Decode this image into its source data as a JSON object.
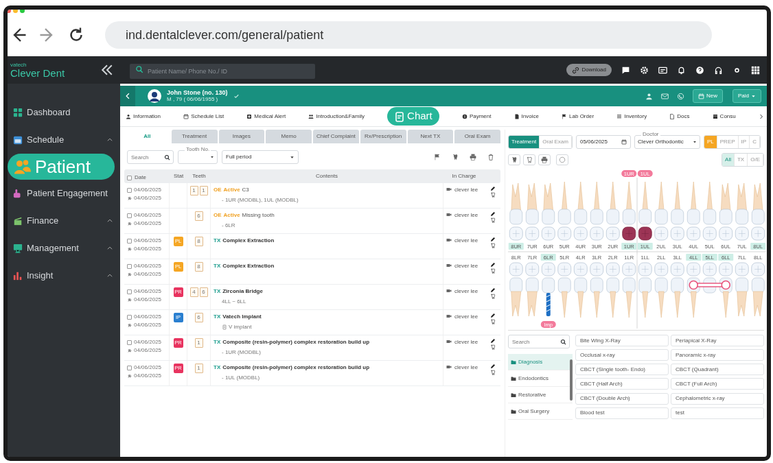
{
  "browser": {
    "dots": [
      {
        "color": "#ff5f57"
      },
      {
        "color": "#febc2e"
      },
      {
        "color": "#28c840"
      }
    ],
    "nav": [
      {
        "kind": "back",
        "disabled": false
      },
      {
        "kind": "forward",
        "disabled": true
      },
      {
        "kind": "reload",
        "disabled": false
      }
    ],
    "url": "ind.dentalclever.com/general/patient"
  },
  "sidebar": {
    "brand_small": "vatech",
    "brand": "Clever Dent",
    "items": [
      {
        "label": "Dashboard",
        "kind": "link",
        "selected": false
      },
      {
        "label": "Schedule",
        "kind": "group",
        "selected": false
      },
      {
        "label": "Patient",
        "kind": "link",
        "selected": true
      },
      {
        "label": "Patient Engagement",
        "kind": "link",
        "selected": false
      },
      {
        "label": "Finance",
        "kind": "group",
        "selected": false
      },
      {
        "label": "Management",
        "kind": "group",
        "selected": false
      },
      {
        "label": "Insight",
        "kind": "group",
        "selected": false
      }
    ]
  },
  "header": {
    "search_placeholder": "Patient Name/ Phone No./ ID",
    "pill": "Download"
  },
  "patient": {
    "name": "John Stone (no. 130)",
    "info": "M , 79 ( 06/06/1955 )",
    "new_label": "New",
    "status_label": "Paid"
  },
  "menu": [
    {
      "label": "Information",
      "selected": false
    },
    {
      "label": "Schedule List",
      "selected": false
    },
    {
      "label": "Medical Alert",
      "selected": false
    },
    {
      "label": "Introduction&Family",
      "selected": false
    },
    {
      "label": "Chart",
      "selected": true
    },
    {
      "label": "Payment",
      "selected": false
    },
    {
      "label": "Invoice",
      "selected": false
    },
    {
      "label": "Lab Order",
      "selected": false
    },
    {
      "label": "Inventory",
      "selected": false
    },
    {
      "label": "Docs",
      "selected": false
    },
    {
      "label": "Consu",
      "selected": false
    }
  ],
  "subtabs": [
    {
      "label": "All",
      "selected": true
    },
    {
      "label": "Treatment",
      "selected": false
    },
    {
      "label": "Images",
      "selected": false
    },
    {
      "label": "Memo",
      "selected": false
    },
    {
      "label": "Chief Complaint",
      "selected": false
    },
    {
      "label": "Rx/Prescription",
      "selected": false
    },
    {
      "label": "Next TX",
      "selected": false
    },
    {
      "label": "Oral Exam",
      "selected": false
    }
  ],
  "filters": {
    "search_placeholder": "Search",
    "tooth_label": "Tooth No.",
    "period": "Full period"
  },
  "table": {
    "all_checked": false,
    "columns": [
      "Date",
      "Stat",
      "Teeth",
      "Contents",
      "In Charge"
    ],
    "rows": [
      {
        "checked": false,
        "date1": "04/06/2025",
        "date2": "04/06/2025",
        "teeth": [
          "1",
          "1"
        ],
        "kind": "exam",
        "prefix": "OE",
        "status": "Active",
        "title": "C3",
        "detail": "- 1UR (MODBL), 1UL (MODBL)",
        "doctor": "clever lee"
      },
      {
        "checked": false,
        "date1": "04/06/2025",
        "date2": "04/06/2025",
        "teeth": [
          "6"
        ],
        "kind": "exam",
        "prefix": "OE",
        "status": "Active",
        "title": "Missing tooth",
        "detail": "- 6LR",
        "doctor": "clever lee"
      },
      {
        "checked": false,
        "date1": "04/06/2025",
        "date2": "04/06/2025",
        "stat": {
          "text": "PL",
          "color": "#f5a623"
        },
        "teeth": [
          "8"
        ],
        "kind": "treatment",
        "prefix": "TX",
        "title": "Complex Extraction",
        "doctor": "clever lee"
      },
      {
        "checked": false,
        "date1": "04/06/2025",
        "date2": "04/06/2025",
        "stat": {
          "text": "PL",
          "color": "#f5a623"
        },
        "teeth": [
          "8"
        ],
        "kind": "treatment",
        "prefix": "TX",
        "title": "Complex Extraction",
        "doctor": "clever lee"
      },
      {
        "checked": false,
        "date1": "04/06/2025",
        "date2": "04/06/2025",
        "stat": {
          "text": "PR",
          "color": "#e8335f"
        },
        "teeth": [
          "4",
          "6"
        ],
        "kind": "treatment",
        "prefix": "TX",
        "title": "Zirconia Bridge",
        "detail": "4LL ~ 6LL",
        "doctor": "clever lee"
      },
      {
        "checked": false,
        "date1": "04/06/2025",
        "date2": "04/06/2025",
        "stat": {
          "text": "IP",
          "color": "#2a7fd0"
        },
        "teeth": [
          "6"
        ],
        "kind": "treatment",
        "prefix": "TX",
        "title": "Vatech Implant",
        "detail": "V implant",
        "detail_icon": true,
        "doctor": "clever lee"
      },
      {
        "checked": false,
        "date1": "04/06/2025",
        "date2": "04/06/2025",
        "stat": {
          "text": "PR",
          "color": "#e8335f"
        },
        "teeth": [
          "1"
        ],
        "kind": "treatment",
        "prefix": "TX",
        "title": "Composite (resin-polymer) complex restoration build up",
        "detail": "- 1UR (MODBL)",
        "doctor": "clever lee"
      },
      {
        "checked": false,
        "date1": "04/06/2025",
        "date2": "04/06/2025",
        "stat": {
          "text": "PR",
          "color": "#e8335f"
        },
        "teeth": [
          "1"
        ],
        "kind": "treatment",
        "prefix": "TX",
        "title": "Composite (resin-polymer) complex restoration build up",
        "detail": "- 1UL (MODBL)",
        "doctor": "clever lee"
      }
    ]
  },
  "chart_panel": {
    "mode_tabs": [
      {
        "label": "Treatment",
        "selected": true
      },
      {
        "label": "Oral Exam",
        "selected": false
      }
    ],
    "date": "05/06/2025",
    "doctor_label": "Doctor",
    "doctor": "Clever Orthodontic",
    "plan_tabs": [
      {
        "label": "PL",
        "selected": true
      },
      {
        "label": "PREP",
        "selected": false
      },
      {
        "label": "IP",
        "selected": false
      },
      {
        "label": "C",
        "selected": false
      }
    ],
    "filter_tabs": [
      {
        "label": "All",
        "selected": true
      },
      {
        "label": "TX",
        "selected": false
      },
      {
        "label": "O/E",
        "selected": false
      }
    ],
    "upper_teeth": [
      {
        "label": "8UR",
        "highlighted": true,
        "selected": false
      },
      {
        "label": "7UR",
        "highlighted": false,
        "selected": false
      },
      {
        "label": "6UR",
        "highlighted": false,
        "selected": false
      },
      {
        "label": "5UR",
        "highlighted": false,
        "selected": false
      },
      {
        "label": "4UR",
        "highlighted": false,
        "selected": false
      },
      {
        "label": "3UR",
        "highlighted": false,
        "selected": false
      },
      {
        "label": "2UR",
        "highlighted": false,
        "selected": false
      },
      {
        "label": "1UR",
        "highlighted": true,
        "selected": true,
        "badge": "1UR"
      },
      {
        "label": "1UL",
        "highlighted": true,
        "selected": true,
        "badge": "1UL"
      },
      {
        "label": "2UL",
        "highlighted": false,
        "selected": false
      },
      {
        "label": "3UL",
        "highlighted": false,
        "selected": false
      },
      {
        "label": "4UL",
        "highlighted": false,
        "selected": false
      },
      {
        "label": "5UL",
        "highlighted": false,
        "selected": false
      },
      {
        "label": "6UL",
        "highlighted": false,
        "selected": false
      },
      {
        "label": "7UL",
        "highlighted": false,
        "selected": false
      },
      {
        "label": "8UL",
        "highlighted": true,
        "selected": false
      }
    ],
    "lower_teeth": [
      {
        "label": "8LR",
        "highlighted": false,
        "kind": "normal"
      },
      {
        "label": "7LR",
        "highlighted": false,
        "kind": "normal"
      },
      {
        "label": "6LR",
        "highlighted": true,
        "kind": "implant",
        "badge": "Imp"
      },
      {
        "label": "5LR",
        "highlighted": false,
        "kind": "normal"
      },
      {
        "label": "4LR",
        "highlighted": false,
        "kind": "normal"
      },
      {
        "label": "3LR",
        "highlighted": false,
        "kind": "normal"
      },
      {
        "label": "2LR",
        "highlighted": false,
        "kind": "normal"
      },
      {
        "label": "1LR",
        "highlighted": false,
        "kind": "normal"
      },
      {
        "label": "1LL",
        "highlighted": false,
        "kind": "normal"
      },
      {
        "label": "2LL",
        "highlighted": false,
        "kind": "normal"
      },
      {
        "label": "3LL",
        "highlighted": false,
        "kind": "normal"
      },
      {
        "label": "4LL",
        "highlighted": true,
        "kind": "abutment"
      },
      {
        "label": "5LL",
        "highlighted": true,
        "kind": "pontic"
      },
      {
        "label": "6LL",
        "highlighted": true,
        "kind": "abutment"
      },
      {
        "label": "7LL",
        "highlighted": false,
        "kind": "normal"
      },
      {
        "label": "8LL",
        "highlighted": false,
        "kind": "normal"
      }
    ]
  },
  "procedures": {
    "search_placeholder": "Search",
    "categories": [
      {
        "label": "Diagnosis",
        "selected": true
      },
      {
        "label": "Endodontics",
        "selected": false
      },
      {
        "label": "Restorative",
        "selected": false
      },
      {
        "label": "Oral Surgery",
        "selected": false
      }
    ],
    "items": [
      "Bite Wing X-Ray",
      "Periapical X-Ray",
      "Occlusal x-ray",
      "Panoramic x-ray",
      "CBCT (Single tooth- Endo)",
      "CBCT (Quadrant)",
      "CBCT (Half Arch)",
      "CBCT (Full Arch)",
      "CBCT (Double Arch)",
      "Cephalometric x-ray",
      "Blood test",
      "test"
    ]
  }
}
